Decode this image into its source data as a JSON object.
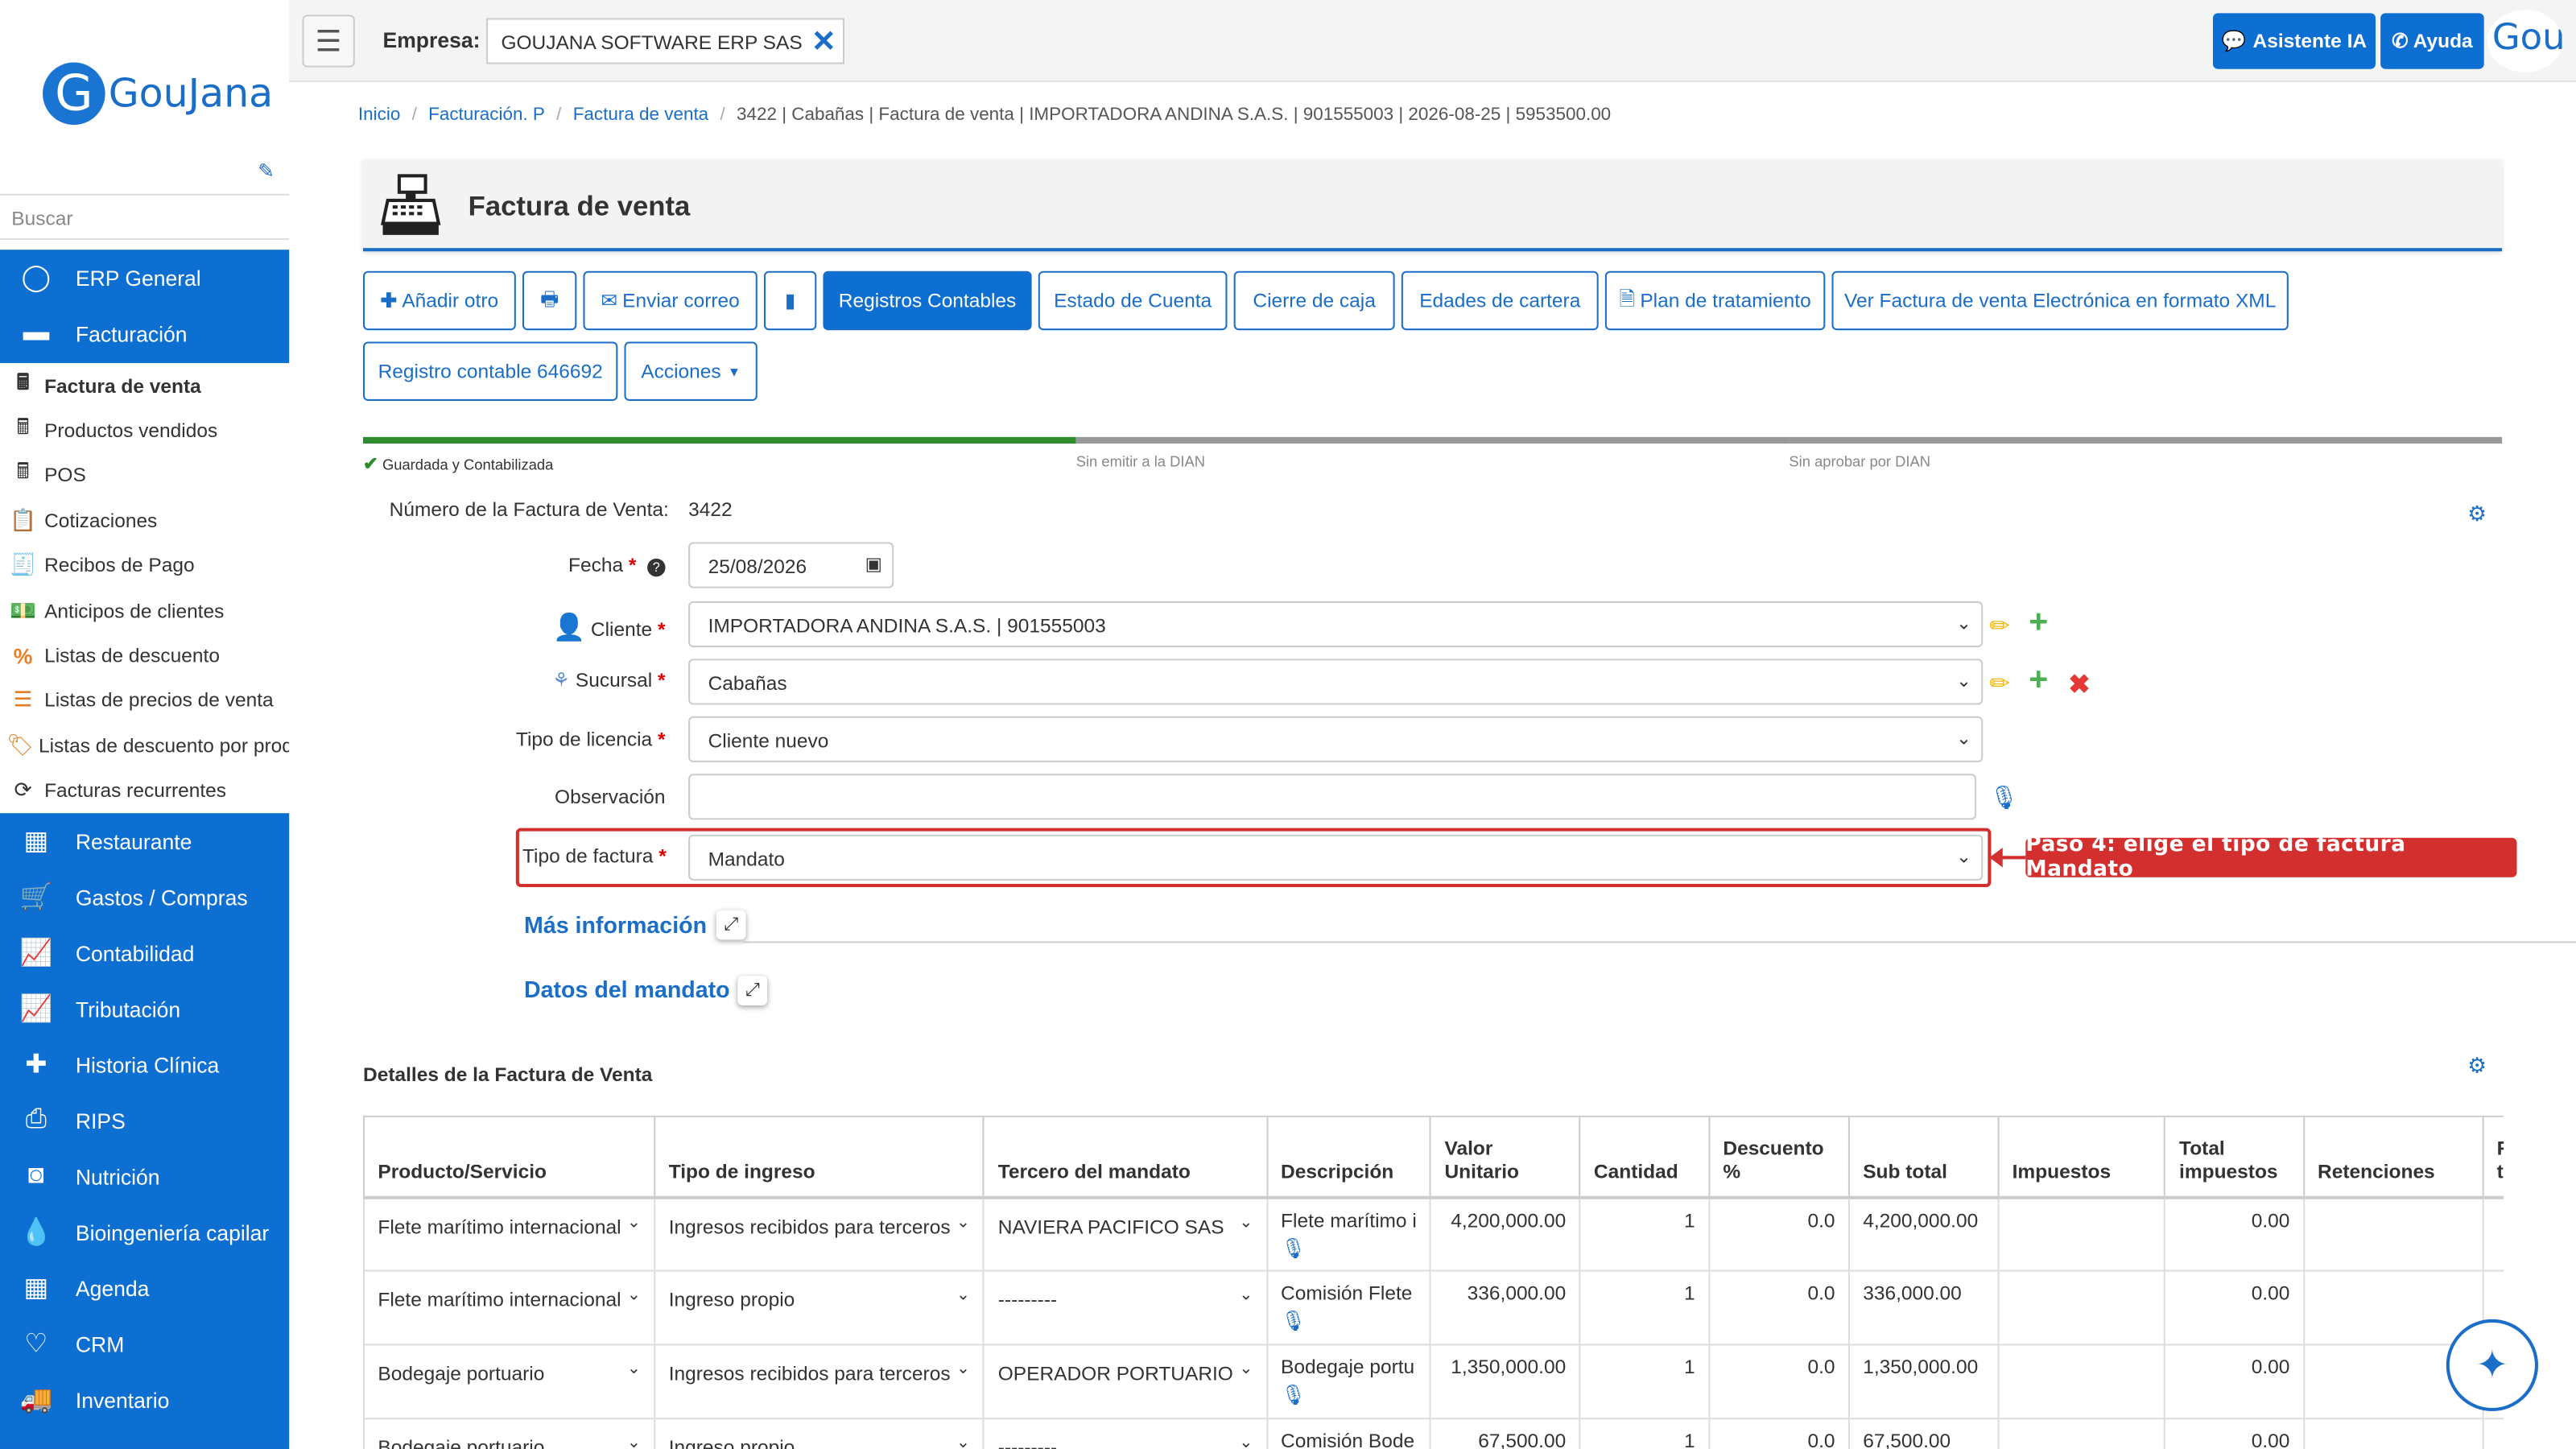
{
  "brand": {
    "logo_letter": "G",
    "logo_text": "GouJana"
  },
  "sidebar": {
    "search_placeholder": "Buscar",
    "top_items": [
      {
        "label": "ERP General"
      },
      {
        "label": "Facturación"
      }
    ],
    "sub_items": [
      {
        "label": "Factura de venta"
      },
      {
        "label": "Productos vendidos"
      },
      {
        "label": "POS"
      },
      {
        "label": "Cotizaciones"
      },
      {
        "label": "Recibos de Pago"
      },
      {
        "label": "Anticipos de clientes"
      },
      {
        "label": "Listas de descuento"
      },
      {
        "label": "Listas de precios de venta"
      },
      {
        "label": "Listas de descuento por producto"
      },
      {
        "label": "Facturas recurrentes"
      }
    ],
    "bottom_items": [
      {
        "label": "Restaurante"
      },
      {
        "label": "Gastos / Compras"
      },
      {
        "label": "Contabilidad"
      },
      {
        "label": "Tributación"
      },
      {
        "label": "Historia Clínica"
      },
      {
        "label": "RIPS"
      },
      {
        "label": "Nutrición"
      },
      {
        "label": "Bioingeniería capilar"
      },
      {
        "label": "Agenda"
      },
      {
        "label": "CRM"
      },
      {
        "label": "Inventario"
      }
    ]
  },
  "topbar": {
    "menu_glyph": "☰",
    "empresa_label": "Empresa:",
    "empresa_value": "GOUJANA SOFTWARE ERP SAS",
    "asistente_label": "Asistente IA",
    "ayuda_label": "Ayuda",
    "avatar_text": "Gou"
  },
  "breadcrumb": {
    "items": [
      "Inicio",
      "Facturación. P",
      "Factura de venta"
    ],
    "current": "3422 | Cabañas | Factura de venta | IMPORTADORA ANDINA S.A.S. | 901555003 | 2026-08-25 | 5953500.00"
  },
  "page": {
    "title": "Factura de venta"
  },
  "toolbar": {
    "add_other": "Añadir otro",
    "send_email": "Enviar correo",
    "registros": "Registros Contables",
    "estado_cuenta": "Estado de Cuenta",
    "cierre_caja": "Cierre de caja",
    "edades_cartera": "Edades de cartera",
    "plan_tratamiento": "Plan de tratamiento",
    "ver_xml": "Ver Factura de venta Electrónica en formato XML",
    "registro_contable": "Registro contable 646692",
    "acciones": "Acciones"
  },
  "progress": {
    "steps": [
      "Guardada y Contabilizada",
      "Sin emitir a la DIAN",
      "Sin aprobar por DIAN"
    ],
    "completed_steps": 1,
    "colors": {
      "done": "#2e8b2e",
      "pending": "#999999"
    }
  },
  "form": {
    "numero_label": "Número de la Factura de Venta:",
    "numero_value": "3422",
    "fecha_label": "Fecha",
    "fecha_value": "25/08/2026",
    "cliente_label": "Cliente",
    "cliente_value": "IMPORTADORA ANDINA S.A.S. | 901555003",
    "sucursal_label": "Sucursal",
    "sucursal_value": "Cabañas",
    "licencia_label": "Tipo de licencia",
    "licencia_value": "Cliente nuevo",
    "observacion_label": "Observación",
    "observacion_value": "",
    "tipo_factura_label": "Tipo de factura",
    "tipo_factura_value": "Mandato",
    "required_mark": "*"
  },
  "callout": {
    "text": "Paso 4: elige el tipo de factura Mandato",
    "color": "#d32f2f"
  },
  "sections": {
    "mas_info": "Más información",
    "datos_mandato": "Datos del mandato"
  },
  "details": {
    "title": "Detalles de la Factura de Venta",
    "columns": [
      "Producto/Servicio",
      "Tipo de ingreso",
      "Tercero del mandato",
      "Descripción",
      "Valor Unitario",
      "Cantidad",
      "Descuento %",
      "Sub total",
      "Impuestos",
      "Total impuestos",
      "Retenciones",
      "Ret. total"
    ],
    "rows": [
      {
        "producto": "Flete marítimo internacional",
        "tipo": "Ingresos recibidos para terceros",
        "tercero": "NAVIERA PACIFICO SAS",
        "descripcion": "Flete marítimo i",
        "valor": "4,200,000.00",
        "cantidad": "1",
        "descuento": "0.0",
        "subtotal": "4,200,000.00",
        "total_imp": "0.00",
        "mic": true
      },
      {
        "producto": "Flete marítimo internacional",
        "tipo": "Ingreso propio",
        "tercero": "---------",
        "descripcion": "Comisión Flete",
        "valor": "336,000.00",
        "cantidad": "1",
        "descuento": "0.0",
        "subtotal": "336,000.00",
        "total_imp": "0.00",
        "mic": true
      },
      {
        "producto": "Bodegaje portuario",
        "tipo": "Ingresos recibidos para terceros",
        "tercero": "OPERADOR PORTUARIO",
        "descripcion": "Bodegaje portu",
        "valor": "1,350,000.00",
        "cantidad": "1",
        "descuento": "0.0",
        "subtotal": "1,350,000.00",
        "total_imp": "0.00",
        "mic": true
      },
      {
        "producto": "Bodegaje portuario",
        "tipo": "Ingreso propio",
        "tercero": "---------",
        "descripcion": "Comisión Bode",
        "valor": "67,500.00",
        "cantidad": "1",
        "descuento": "0.0",
        "subtotal": "67,500.00",
        "total_imp": "0.00",
        "mic": false
      }
    ]
  },
  "colors": {
    "primary": "#0d6fd1",
    "callout": "#d32f2f"
  }
}
